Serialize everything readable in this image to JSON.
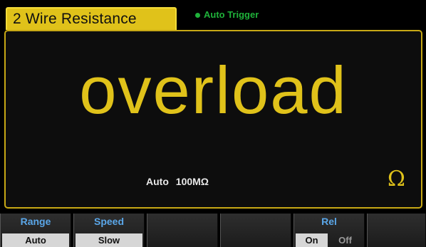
{
  "header": {
    "mode_title": "2 Wire Resistance",
    "trigger_status": "Auto  Trigger",
    "trigger_color": "#1fb23a"
  },
  "display": {
    "reading": "overload",
    "range_mode": "Auto",
    "range_value": "100MΩ",
    "unit_symbol": "Ω",
    "accent_color": "#e0c21a"
  },
  "softkeys": [
    {
      "title": "Range",
      "value": "Auto"
    },
    {
      "title": "Speed",
      "value": "Slow"
    },
    {
      "title": "",
      "value": ""
    },
    {
      "title": "",
      "value": ""
    },
    {
      "title": "Rel",
      "on": "On",
      "off": "Off"
    },
    {
      "title": "",
      "value": ""
    }
  ]
}
